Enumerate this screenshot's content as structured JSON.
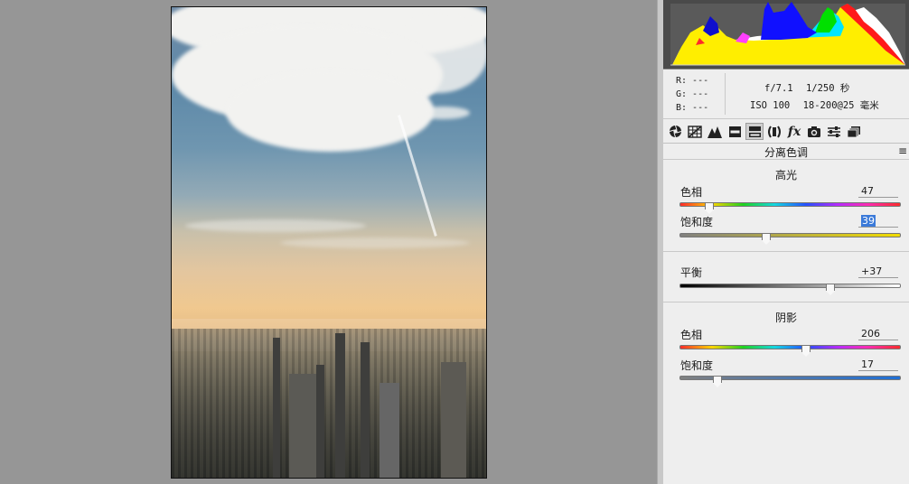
{
  "info": {
    "rgb": [
      "R: ---",
      "G: ---",
      "B: ---"
    ],
    "aperture": "f/7.1",
    "shutter": "1/250 秒",
    "iso": "ISO 100",
    "lens": "18-200@25 毫米"
  },
  "toolbar": {
    "icons": [
      "basic-aperture-icon",
      "tone-curve-grid-icon",
      "mountain-detail-icon",
      "hsl-bars-icon",
      "split-toning-icon",
      "lens-corrections-icon",
      "fx-icon",
      "camera-icon",
      "sliders-icon",
      "presets-icon"
    ],
    "active": "split-toning-icon"
  },
  "panel": {
    "title": "分离色调",
    "menu_icon": "≡",
    "highlights": {
      "title": "高光",
      "hue_label": "色相",
      "hue_value": "47",
      "hue_fraction": 0.13,
      "sat_label": "饱和度",
      "sat_value": "39",
      "sat_fraction": 0.39
    },
    "balance": {
      "label": "平衡",
      "value": "+37",
      "fraction": 0.685
    },
    "shadows": {
      "title": "阴影",
      "hue_label": "色相",
      "hue_value": "206",
      "hue_fraction": 0.572,
      "sat_label": "饱和度",
      "sat_value": "17",
      "sat_fraction": 0.17
    }
  }
}
